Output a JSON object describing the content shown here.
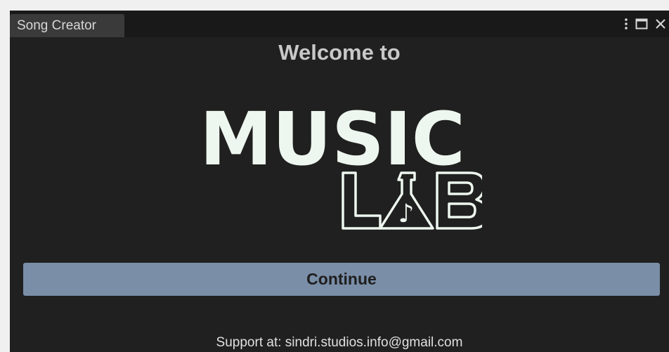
{
  "window": {
    "tab_title": "Song Creator",
    "controls": {
      "more_icon": "vertical-ellipsis",
      "maximize_icon": "maximize-square",
      "close_icon": "close-x"
    }
  },
  "main": {
    "welcome_text": "Welcome to",
    "logo": {
      "line1": "MUSIC",
      "line2": "LAB",
      "note_symbol": "♪"
    },
    "continue_label": "Continue",
    "support_text": "Support at: sindri.studios.info@gmail.com"
  },
  "colors": {
    "background": "#202020",
    "tabbar": "#191919",
    "tab": "#3a3a3a",
    "button": "#7a8ea8",
    "logo": "#eef7ef"
  }
}
